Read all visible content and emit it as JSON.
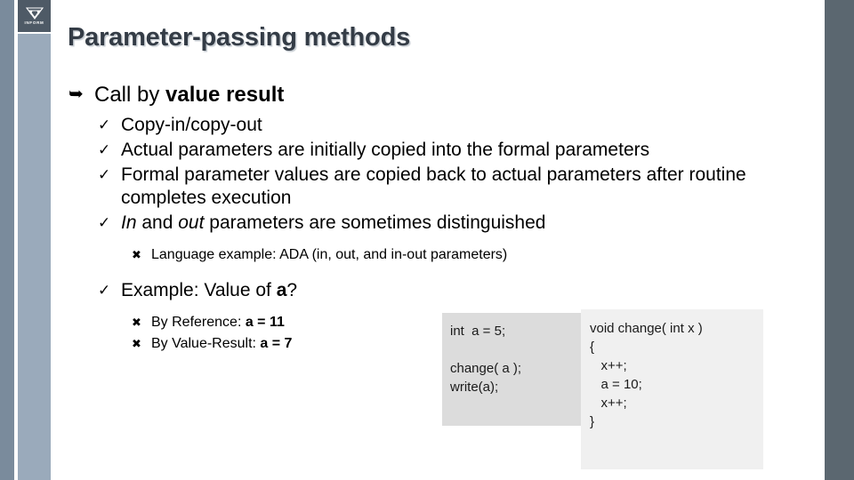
{
  "slide": {
    "title": "Parameter-passing methods",
    "logo": {
      "icon": "triangle-logo-icon",
      "caption": "INFORM"
    },
    "colors": {
      "bar_left_dark": "#7a8b9c",
      "bar_left_light": "#9aaabb",
      "bar_right_dark": "#5b6770",
      "title": "#343c46",
      "code_left_bg": "#dcdcdc",
      "code_right_bg": "#f0f0f0"
    }
  },
  "bullets": {
    "level1": {
      "marker": "hollow-arrow-icon",
      "text_plain": "Call by ",
      "text_bold": "value result"
    },
    "level2_marker": "check-icon",
    "level3_marker": "cross-icon",
    "items": [
      {
        "text": "Copy-in/copy-out"
      },
      {
        "text": "Actual parameters are initially copied into the formal parameters"
      },
      {
        "text": "Formal parameter values are copied back to actual parameters after routine completes execution"
      }
    ],
    "in_out": {
      "word_in": "In",
      "mid": " and ",
      "word_out": "out",
      "tail": " parameters are sometimes distinguished"
    },
    "language_example": "Language example:  ADA (in, out, and in-out parameters)",
    "example_heading": {
      "lead": "Example: Value of ",
      "bold": "a",
      "tail": "?"
    },
    "results": [
      {
        "label": "By Reference:  ",
        "value": "a = 11"
      },
      {
        "label": "By Value-Result:  ",
        "value": "a = 7"
      }
    ]
  },
  "code": {
    "left": "int  a = 5;\n\nchange( a );\nwrite(a);",
    "right": "void change( int x )\n{\n   x++;\n   a = 10;\n   x++;\n}"
  }
}
